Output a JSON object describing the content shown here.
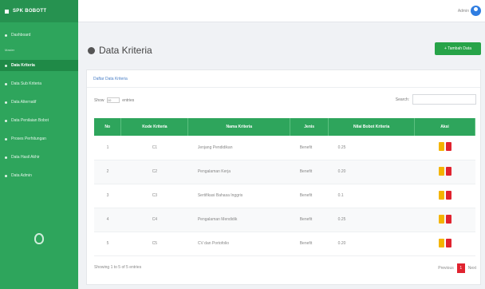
{
  "app": {
    "brand": "SPK BOBOTT"
  },
  "sidebar": {
    "items": [
      {
        "label": "Dashboard",
        "active": false
      },
      {
        "label": "Data Kriteria",
        "active": true
      },
      {
        "label": "Data Sub Kriteria",
        "active": false
      },
      {
        "label": "Data Alternatif",
        "active": false
      },
      {
        "label": "Data Penilaian Bobot",
        "active": false
      },
      {
        "label": "Proses Perhitungan",
        "active": false
      },
      {
        "label": "Data Hasil Akhir",
        "active": false
      },
      {
        "label": "Data Admin",
        "active": false
      }
    ],
    "section_label": "Master"
  },
  "topbar": {
    "user_name": "Admin"
  },
  "page": {
    "title": "Data Kriteria",
    "add_button": "+ Tambah Data"
  },
  "card": {
    "header": "Daftar Data Kriteria",
    "show_prefix": "Show",
    "show_value": "10",
    "show_suffix": "entries",
    "search_label": "Search:",
    "columns": [
      "No",
      "Kode Kriteria",
      "Nama Kriteria",
      "Jenis",
      "Nilai Bobot Kriteria",
      "Aksi"
    ],
    "rows": [
      {
        "no": "1",
        "kode": "C1",
        "nama": "Jenjang Pendidikan",
        "jenis": "Benefit",
        "bobot": "0.25"
      },
      {
        "no": "2",
        "kode": "C2",
        "nama": "Pengalaman Kerja",
        "jenis": "Benefit",
        "bobot": "0.20"
      },
      {
        "no": "3",
        "kode": "C3",
        "nama": "Sertifikasi Bahasa Inggris",
        "jenis": "Benefit",
        "bobot": "0.1"
      },
      {
        "no": "4",
        "kode": "C4",
        "nama": "Pengalaman Mendidik",
        "jenis": "Benefit",
        "bobot": "0.25"
      },
      {
        "no": "5",
        "kode": "C5",
        "nama": "CV dan Portofolio",
        "jenis": "Benefit",
        "bobot": "0.20"
      }
    ],
    "footer_info": "Showing 1 to 5 of 5 entries",
    "pager": {
      "prev": "Previous",
      "page": "1",
      "next": "Next"
    }
  },
  "colors": {
    "sidebar": "#2ea55c",
    "header_row": "#2ea55c",
    "add_button": "#27a348",
    "edit": "#f4b400",
    "delete": "#e0232f",
    "user": "#2f7de1"
  },
  "icons": {
    "brand": "square-icon",
    "title": "globe-icon",
    "user": "user-circle-icon",
    "sidebar_footer": "shield-icon"
  }
}
